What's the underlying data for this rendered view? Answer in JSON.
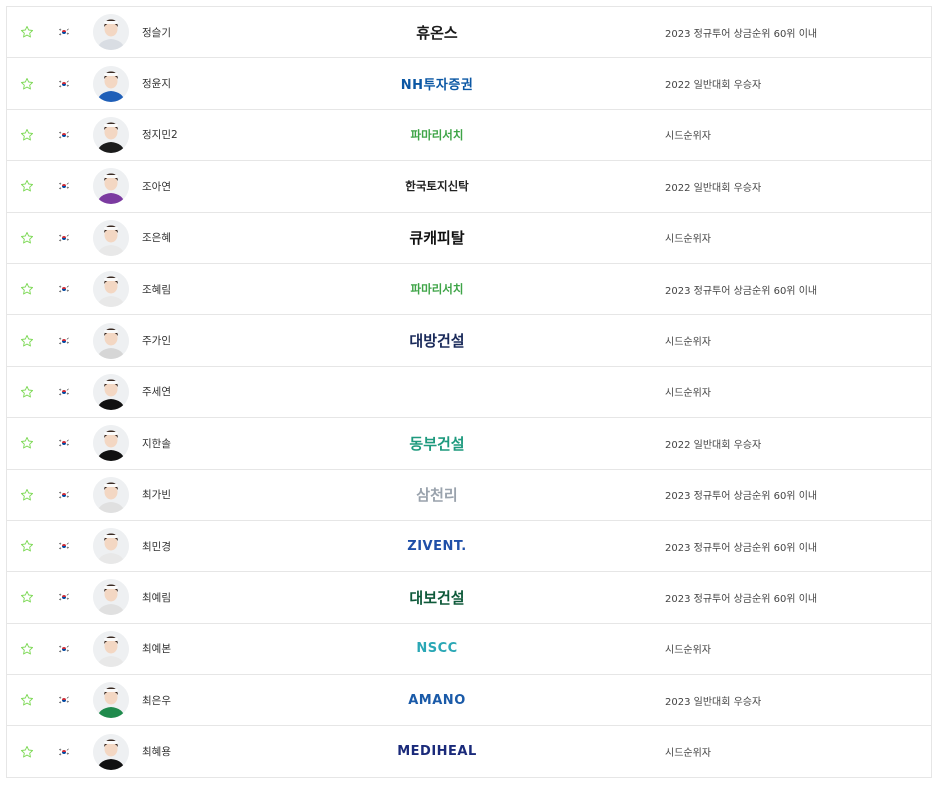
{
  "colors": {
    "star": "#7ed957",
    "flag_red": "#cd2e3a",
    "flag_blue": "#0047a0",
    "row_border": "#e6e6e6"
  },
  "icons": {
    "favorite": "star-outline-icon",
    "nationality": "korea-flag-icon"
  },
  "players": [
    {
      "name": "정슬기",
      "sponsor": "휴온스",
      "sponsor_color": "#1b1b1b",
      "qualification": "2023 정규투어 상금순위 60위 이내",
      "shirt": "#d9dde3"
    },
    {
      "name": "정윤지",
      "sponsor": "NH투자증권",
      "sponsor_color": "#0b57a4",
      "qualification": "2022 일반대회 우승자",
      "shirt": "#1f5fb8"
    },
    {
      "name": "정지민2",
      "sponsor": "파마리서치",
      "sponsor_color": "#3ea447",
      "qualification": "시드순위자",
      "shirt": "#1b1b1b"
    },
    {
      "name": "조아연",
      "sponsor": "한국토지신탁",
      "sponsor_color": "#222222",
      "qualification": "2022 일반대회 우승자",
      "shirt": "#7b3aa0"
    },
    {
      "name": "조은혜",
      "sponsor": "큐캐피탈",
      "sponsor_color": "#111111",
      "qualification": "시드순위자",
      "shirt": "#e8e8e8"
    },
    {
      "name": "조혜림",
      "sponsor": "파마리서치",
      "sponsor_color": "#3ea447",
      "qualification": "2023 정규투어 상금순위 60위 이내",
      "shirt": "#e8e8e8"
    },
    {
      "name": "주가인",
      "sponsor": "대방건설",
      "sponsor_color": "#1a2a5a",
      "qualification": "시드순위자",
      "shirt": "#d6d6d6"
    },
    {
      "name": "주세연",
      "sponsor": "",
      "sponsor_color": "#111111",
      "qualification": "시드순위자",
      "shirt": "#111111"
    },
    {
      "name": "지한솔",
      "sponsor": "동부건설",
      "sponsor_color": "#1e9a7e",
      "qualification": "2022 일반대회 우승자",
      "shirt": "#111111"
    },
    {
      "name": "최가빈",
      "sponsor": "삼천리",
      "sponsor_color": "#9aa3ad",
      "qualification": "2023 정규투어 상금순위 60위 이내",
      "shirt": "#e0e0e0"
    },
    {
      "name": "최민경",
      "sponsor": "ZIVENT.",
      "sponsor_color": "#1f4fa8",
      "qualification": "2023 정규투어 상금순위 60위 이내",
      "shirt": "#e8e8e8"
    },
    {
      "name": "최예림",
      "sponsor": "대보건설",
      "sponsor_color": "#0e5a3a",
      "qualification": "2023 정규투어 상금순위 60위 이내",
      "shirt": "#e0e0e0"
    },
    {
      "name": "최예본",
      "sponsor": "NSCC",
      "sponsor_color": "#2aa7b5",
      "qualification": "시드순위자",
      "shirt": "#e8e8e8"
    },
    {
      "name": "최은우",
      "sponsor": "AMANO",
      "sponsor_color": "#1a5aa8",
      "qualification": "2023 일반대회 우승자",
      "shirt": "#1f8a4c"
    },
    {
      "name": "최혜용",
      "sponsor": "MEDIHEAL",
      "sponsor_color": "#1a2a7a",
      "qualification": "시드순위자",
      "shirt": "#111111"
    }
  ]
}
